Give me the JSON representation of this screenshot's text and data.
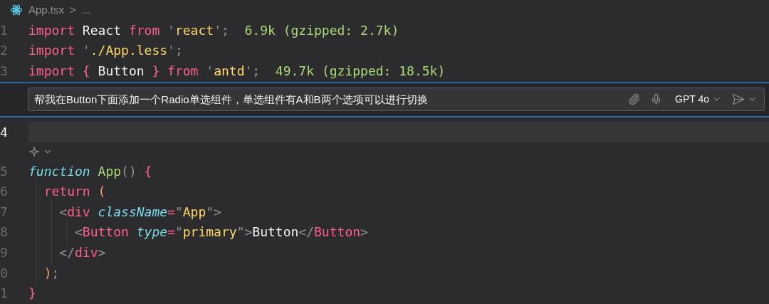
{
  "breadcrumb": {
    "file": "App.tsx",
    "separator": ">",
    "more": "..."
  },
  "lines_before": [
    {
      "number": "1",
      "tokens": [
        {
          "kind": "keyword",
          "text": "import"
        },
        {
          "kind": "plain",
          "text": " React "
        },
        {
          "kind": "keyword",
          "text": "from"
        },
        {
          "kind": "punct",
          "text": " '"
        },
        {
          "kind": "string",
          "text": "react"
        },
        {
          "kind": "punct",
          "text": "';"
        },
        {
          "kind": "hint",
          "text": "  6.9k (gzipped: 2.7k)"
        }
      ]
    },
    {
      "number": "2",
      "tokens": [
        {
          "kind": "keyword",
          "text": "import"
        },
        {
          "kind": "punct",
          "text": " '"
        },
        {
          "kind": "string",
          "text": "./App.less"
        },
        {
          "kind": "punct",
          "text": "';"
        }
      ]
    },
    {
      "number": "3",
      "tokens": [
        {
          "kind": "keyword",
          "text": "import"
        },
        {
          "kind": "keyword",
          "text": " {"
        },
        {
          "kind": "plain",
          "text": " Button "
        },
        {
          "kind": "keyword",
          "text": "}"
        },
        {
          "kind": "keyword",
          "text": " from"
        },
        {
          "kind": "punct",
          "text": " '"
        },
        {
          "kind": "string",
          "text": "antd"
        },
        {
          "kind": "punct",
          "text": "';"
        },
        {
          "kind": "hint",
          "text": "  49.7k (gzipped: 18.5k)"
        }
      ]
    }
  ],
  "chat": {
    "value": "帮我在Button下面添加一个Radio单选组件，单选组件有A和B两个选项可以进行切换",
    "model": "GPT 4o"
  },
  "current_line": {
    "number": "4"
  },
  "lines_after": [
    {
      "number": "5",
      "tokens": [
        {
          "kind": "storage",
          "text": "function"
        },
        {
          "kind": "name",
          "text": " App"
        },
        {
          "kind": "punct",
          "text": "() "
        },
        {
          "kind": "keyword",
          "text": "{"
        }
      ]
    },
    {
      "number": "6",
      "tokens": [
        {
          "kind": "keyword",
          "text": "  return"
        },
        {
          "kind": "paren",
          "text": " ("
        }
      ]
    },
    {
      "number": "7",
      "tokens": [
        {
          "kind": "punct",
          "text": "    <"
        },
        {
          "kind": "keyword",
          "text": "div"
        },
        {
          "kind": "attr",
          "text": " className"
        },
        {
          "kind": "keyword",
          "text": "="
        },
        {
          "kind": "punct",
          "text": "\""
        },
        {
          "kind": "string",
          "text": "App"
        },
        {
          "kind": "punct",
          "text": "\">"
        }
      ]
    },
    {
      "number": "8",
      "tokens": [
        {
          "kind": "punct",
          "text": "      <"
        },
        {
          "kind": "keyword",
          "text": "Button"
        },
        {
          "kind": "attr",
          "text": " type"
        },
        {
          "kind": "keyword",
          "text": "="
        },
        {
          "kind": "punct",
          "text": "\""
        },
        {
          "kind": "string",
          "text": "primary"
        },
        {
          "kind": "punct",
          "text": "\">"
        },
        {
          "kind": "plain",
          "text": "Button"
        },
        {
          "kind": "punct",
          "text": "</"
        },
        {
          "kind": "keyword",
          "text": "Button"
        },
        {
          "kind": "punct",
          "text": ">"
        }
      ]
    },
    {
      "number": "9",
      "tokens": [
        {
          "kind": "punct",
          "text": "    </"
        },
        {
          "kind": "keyword",
          "text": "div"
        },
        {
          "kind": "punct",
          "text": ">"
        }
      ]
    },
    {
      "number": "0",
      "tokens": [
        {
          "kind": "paren",
          "text": "  )"
        },
        {
          "kind": "punct",
          "text": ";"
        }
      ]
    },
    {
      "number": "1",
      "tokens": [
        {
          "kind": "keyword",
          "text": "}"
        }
      ]
    }
  ]
}
